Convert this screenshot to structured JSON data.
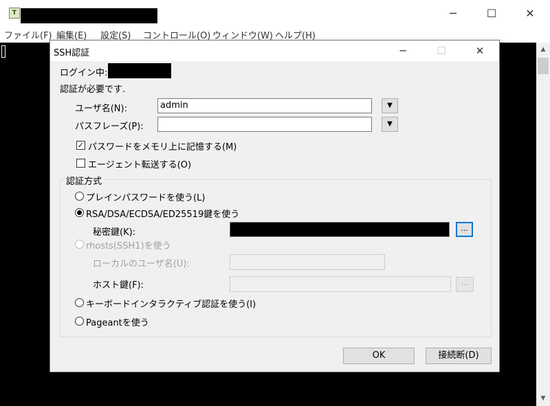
{
  "window": {
    "title_redacted": true,
    "app_icon": "teraterm-icon",
    "controls": {
      "minimize": "─",
      "maximize": "☐",
      "close": "✕"
    },
    "menu": [
      "ファイル(F)",
      "編集(E)",
      "設定(S)",
      "コントロール(O)",
      "ウィンドウ(W)",
      "ヘルプ(H)"
    ]
  },
  "scrollbar": {
    "up": "▲",
    "down": "▼"
  },
  "dialog": {
    "title": "SSH認証",
    "controls": {
      "minimize": "─",
      "maximize": "☐",
      "close": "✕"
    },
    "login_label": "ログイン中:",
    "auth_required": "認証が必要です.",
    "username_label": "ユーザ名(N):",
    "username_value": "admin",
    "passphrase_label": "パスフレーズ(P):",
    "passphrase_value": "",
    "dropdown_arrow": "▼",
    "remember_password": {
      "label": "パスワードをメモリ上に記憶する(M)",
      "checked": true,
      "mark": "✓"
    },
    "agent_forward": {
      "label": "エージェント転送する(O)",
      "checked": false
    },
    "auth_method_group": "認証方式",
    "methods": {
      "plain": "プレインパスワードを使う(L)",
      "rsa": "RSA/DSA/ECDSA/ED25519鍵を使う",
      "rhosts": "rhosts(SSH1)を使う",
      "keyboard": "キーボードインタラクティブ認証を使う(I)",
      "pageant": "Pageantを使う"
    },
    "selected_method": "rsa",
    "private_key_label": "秘密鍵(K):",
    "local_user_label": "ローカルのユーザ名(U):",
    "host_key_label": "ホスト鍵(F):",
    "browse_label": "...",
    "ok_label": "OK",
    "disconnect_label": "接続断(D)"
  }
}
